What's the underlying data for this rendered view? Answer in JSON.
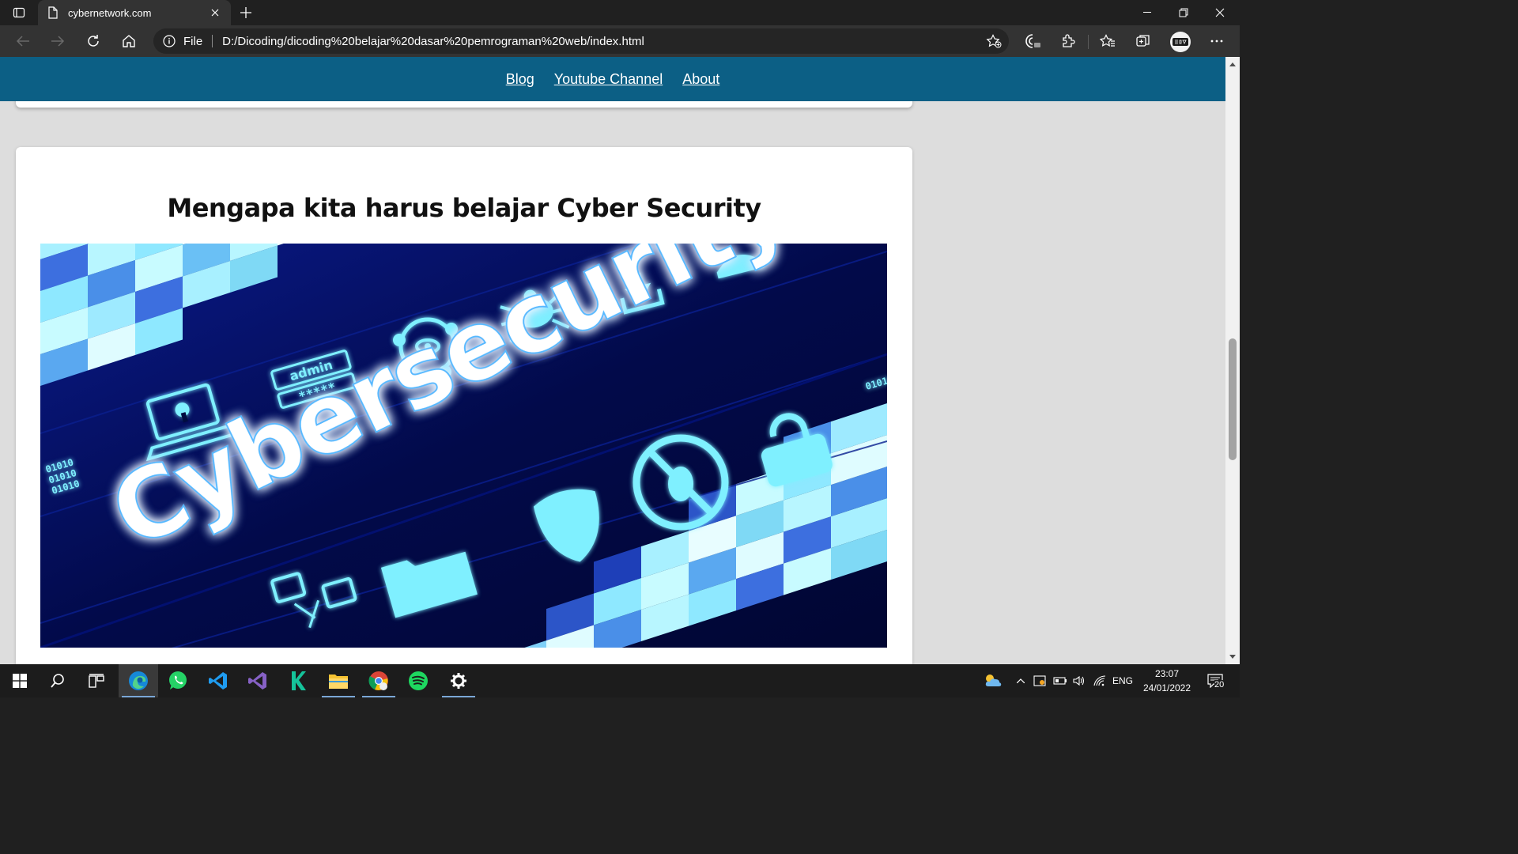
{
  "browser": {
    "tab": {
      "title": "cybernetwork.com"
    },
    "address": {
      "scheme_label": "File",
      "url": "D:/Dicoding/dicoding%20belajar%20dasar%20pemrograman%20web/index.html"
    }
  },
  "page": {
    "nav": {
      "links": [
        "Blog",
        "Youtube Channel",
        "About"
      ]
    },
    "article": {
      "heading": "Mengapa kita harus belajar Cyber Security",
      "hero_image": {
        "word": "Cybersecurity",
        "badge_text": "admin",
        "badge_password": "*****",
        "binary_text": "01010",
        "accent_colors": [
          "#01083a",
          "#0a1fa8",
          "#8ee8ff",
          "#e8fbff"
        ]
      }
    }
  },
  "taskbar": {
    "apps": [
      "start-icon",
      "search-icon",
      "task-view-icon",
      "edge-icon",
      "whatsapp-icon",
      "vscode-icon",
      "visual-studio-icon",
      "kotlin-icon",
      "file-explorer-icon",
      "chrome-icon",
      "spotify-icon",
      "settings-icon"
    ],
    "language": "ENG",
    "time": "23:07",
    "date": "24/01/2022",
    "notification_count": "20"
  }
}
